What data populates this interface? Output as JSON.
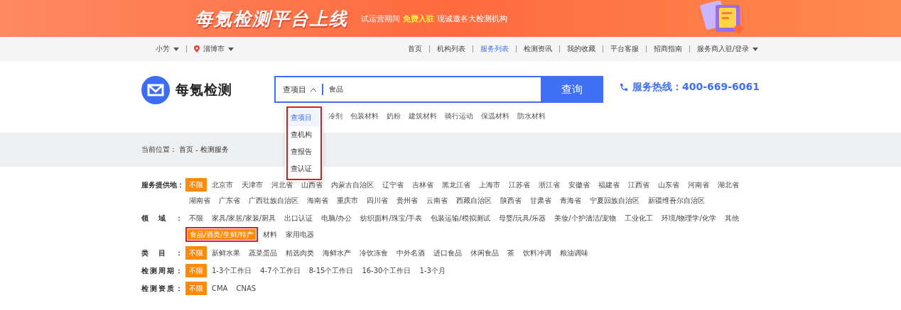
{
  "banner": {
    "title": "每氪检测平台上线",
    "lead": "试运营期间",
    "highlight": "免费入驻",
    "tail": "现诚邀各大检测机构"
  },
  "top_nav": {
    "user": "小芳",
    "city": "淄博市",
    "links": [
      {
        "label": "首页",
        "selected": false,
        "dropdown": false
      },
      {
        "label": "机构列表",
        "selected": false,
        "dropdown": false
      },
      {
        "label": "服务列表",
        "selected": true,
        "dropdown": false
      },
      {
        "label": "检测资讯",
        "selected": false,
        "dropdown": false
      },
      {
        "label": "我的收藏",
        "selected": false,
        "dropdown": false
      },
      {
        "label": "平台客服",
        "selected": false,
        "dropdown": false
      },
      {
        "label": "招商指南",
        "selected": false,
        "dropdown": false
      },
      {
        "label": "服务商入驻/登录",
        "selected": false,
        "dropdown": true
      }
    ]
  },
  "header": {
    "logo": "每氪检测",
    "search": {
      "type_label": "查项目",
      "value": "食品",
      "button": "查询",
      "dropdown": {
        "annotated": true,
        "options": [
          {
            "label": "查项目",
            "selected": true
          },
          {
            "label": "查机构",
            "selected": false
          },
          {
            "label": "查报告",
            "selected": false
          },
          {
            "label": "查认证",
            "selected": false
          }
        ]
      }
    },
    "hot_words": [
      "冷剂",
      "包装材料",
      "奶粉",
      "建筑材料",
      "骑行运动",
      "保温材料",
      "防水材料"
    ],
    "hotline": "服务热线：400-669-6061"
  },
  "breadcrumb": {
    "label": "当前位置：",
    "items": [
      "首页",
      "检测服务"
    ],
    "separator": "-"
  },
  "filters": [
    {
      "label": "服务提供地：",
      "annotated_selection": false,
      "options": [
        {
          "text": "不限",
          "selected": true
        },
        {
          "text": "北京市",
          "selected": false
        },
        {
          "text": "天津市",
          "selected": false
        },
        {
          "text": "河北省",
          "selected": false
        },
        {
          "text": "山西省",
          "selected": false
        },
        {
          "text": "内蒙古自治区",
          "selected": false
        },
        {
          "text": "辽宁省",
          "selected": false
        },
        {
          "text": "吉林省",
          "selected": false
        },
        {
          "text": "黑龙江省",
          "selected": false
        },
        {
          "text": "上海市",
          "selected": false
        },
        {
          "text": "江苏省",
          "selected": false
        },
        {
          "text": "浙江省",
          "selected": false
        },
        {
          "text": "安徽省",
          "selected": false
        },
        {
          "text": "福建省",
          "selected": false
        },
        {
          "text": "江西省",
          "selected": false
        },
        {
          "text": "山东省",
          "selected": false
        },
        {
          "text": "河南省",
          "selected": false
        },
        {
          "text": "湖北省",
          "selected": false
        },
        {
          "text": "湖南省",
          "selected": false
        },
        {
          "text": "广东省",
          "selected": false
        },
        {
          "text": "广西壮族自治区",
          "selected": false
        },
        {
          "text": "海南省",
          "selected": false
        },
        {
          "text": "重庆市",
          "selected": false
        },
        {
          "text": "四川省",
          "selected": false
        },
        {
          "text": "贵州省",
          "selected": false
        },
        {
          "text": "云南省",
          "selected": false
        },
        {
          "text": "西藏自治区",
          "selected": false
        },
        {
          "text": "陕西省",
          "selected": false
        },
        {
          "text": "甘肃省",
          "selected": false
        },
        {
          "text": "青海省",
          "selected": false
        },
        {
          "text": "宁夏回族自治区",
          "selected": false
        },
        {
          "text": "新疆维吾尔自治区",
          "selected": false
        }
      ]
    },
    {
      "label": "领域：",
      "annotated_selection": true,
      "options": [
        {
          "text": "不限",
          "selected": false
        },
        {
          "text": "家具/家居/家装/厨具",
          "selected": false
        },
        {
          "text": "出口认证",
          "selected": false
        },
        {
          "text": "电脑/办公",
          "selected": false
        },
        {
          "text": "纺织面料/珠宝/手表",
          "selected": false
        },
        {
          "text": "包装运输/模拟测试",
          "selected": false
        },
        {
          "text": "母婴/玩具/乐器",
          "selected": false
        },
        {
          "text": "美妆/个护清洁/宠物",
          "selected": false
        },
        {
          "text": "工业化工",
          "selected": false
        },
        {
          "text": "环境/物理学/化学",
          "selected": false
        },
        {
          "text": "其他",
          "selected": false
        },
        {
          "text": "食品/酒类/生鲜/特产",
          "selected": true
        },
        {
          "text": "材料",
          "selected": false
        },
        {
          "text": "家用电器",
          "selected": false
        }
      ]
    },
    {
      "label": "类目：",
      "annotated_selection": false,
      "options": [
        {
          "text": "不限",
          "selected": true
        },
        {
          "text": "新鲜水果",
          "selected": false
        },
        {
          "text": "蔬菜蛋品",
          "selected": false
        },
        {
          "text": "精选肉类",
          "selected": false
        },
        {
          "text": "海鲜水产",
          "selected": false
        },
        {
          "text": "冷饮冻食",
          "selected": false
        },
        {
          "text": "中外名酒",
          "selected": false
        },
        {
          "text": "进口食品",
          "selected": false
        },
        {
          "text": "休闲食品",
          "selected": false
        },
        {
          "text": "茶",
          "selected": false
        },
        {
          "text": "饮料冲调",
          "selected": false
        },
        {
          "text": "粮油调味",
          "selected": false
        }
      ]
    },
    {
      "label": "检测周期：",
      "annotated_selection": false,
      "options": [
        {
          "text": "不限",
          "selected": true
        },
        {
          "text": "1-3个工作日",
          "selected": false
        },
        {
          "text": "4-7个工作日",
          "selected": false
        },
        {
          "text": "8-15个工作日",
          "selected": false
        },
        {
          "text": "16-30个工作日",
          "selected": false
        },
        {
          "text": "1-3个月",
          "selected": false
        }
      ]
    },
    {
      "label": "检测资质：",
      "annotated_selection": false,
      "options": [
        {
          "text": "不限",
          "selected": true
        },
        {
          "text": "CMA",
          "selected": false
        },
        {
          "text": "CNAS",
          "selected": false
        }
      ]
    }
  ]
}
